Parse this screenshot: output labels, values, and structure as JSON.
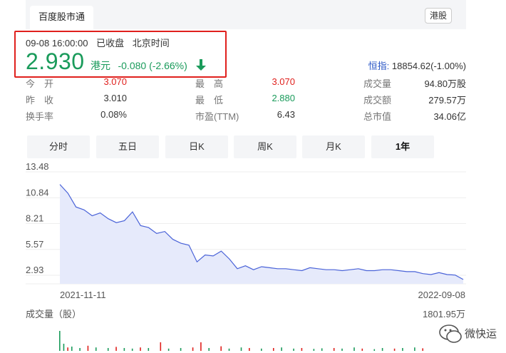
{
  "tab": {
    "label": "百度股市通",
    "badge": "港股"
  },
  "quote": {
    "date": "09-08 16:00:00",
    "status": "已收盘",
    "timezone": "北京时间",
    "price": "2.930",
    "currency": "港元",
    "change": "-0.080 (-2.66%)"
  },
  "index": {
    "label": "恒指:",
    "value": "18854.62(-1.00%)"
  },
  "stats": {
    "row1": [
      {
        "label": "今　开",
        "value": "3.070",
        "color": "red"
      },
      {
        "label": "最　高",
        "value": "3.070",
        "color": "red"
      },
      {
        "label": "成交量",
        "value": "94.80万股"
      }
    ],
    "row2": [
      {
        "label": "昨　收",
        "value": "3.010"
      },
      {
        "label": "最　低",
        "value": "2.880",
        "color": "green"
      },
      {
        "label": "成交额",
        "value": "279.57万"
      }
    ],
    "row3": [
      {
        "label": "换手率",
        "value": "0.08%"
      },
      {
        "label": "市盈(TTM)",
        "value": "6.43"
      },
      {
        "label": "总市值",
        "value": "34.06亿"
      }
    ]
  },
  "periods": [
    "分时",
    "五日",
    "日K",
    "周K",
    "月K",
    "1年"
  ],
  "active_period": "1年",
  "watermark": "微快运",
  "chart_data": {
    "type": "area",
    "y_ticks": [
      "13.48",
      "10.84",
      "8.21",
      "5.57",
      "2.93"
    ],
    "x_labels": [
      "2021-11-11",
      "2022-09-08"
    ],
    "ylim": [
      2.93,
      13.48
    ],
    "line_color": "#4a63d8",
    "fill_color": "#e6eafb",
    "x": [
      0,
      2,
      4,
      6,
      8,
      10,
      12,
      14,
      16,
      18,
      20,
      22,
      24,
      26,
      28,
      30,
      32,
      34,
      36,
      38,
      40,
      42,
      44,
      46,
      48,
      50,
      52,
      54,
      56,
      58,
      60,
      62,
      64,
      66,
      68,
      70,
      72,
      74,
      76,
      78,
      80,
      82,
      84,
      86,
      88,
      90,
      92,
      94,
      96,
      98,
      100
    ],
    "values": [
      12.2,
      11.3,
      9.9,
      9.6,
      9.0,
      9.3,
      8.7,
      8.3,
      8.5,
      9.4,
      8.0,
      7.8,
      7.2,
      7.4,
      6.6,
      6.2,
      6.0,
      4.3,
      5.0,
      4.9,
      5.4,
      4.6,
      3.6,
      3.9,
      3.5,
      3.8,
      3.7,
      3.6,
      3.6,
      3.5,
      3.4,
      3.7,
      3.6,
      3.5,
      3.5,
      3.4,
      3.5,
      3.6,
      3.4,
      3.4,
      3.5,
      3.5,
      3.4,
      3.3,
      3.3,
      3.1,
      3.0,
      3.2,
      3.0,
      2.95,
      2.5
    ],
    "volume_label": "成交量（股）",
    "volume_max": "1801.95万",
    "volume": [
      {
        "x": 0,
        "v": 0.7,
        "c": "g"
      },
      {
        "x": 1,
        "v": 0.25,
        "c": "g"
      },
      {
        "x": 2,
        "v": 0.12,
        "c": "r"
      },
      {
        "x": 3,
        "v": 0.15,
        "c": "g"
      },
      {
        "x": 5,
        "v": 0.1,
        "c": "g"
      },
      {
        "x": 7,
        "v": 0.18,
        "c": "r"
      },
      {
        "x": 9,
        "v": 0.12,
        "c": "g"
      },
      {
        "x": 12,
        "v": 0.1,
        "c": "g"
      },
      {
        "x": 14,
        "v": 0.14,
        "c": "r"
      },
      {
        "x": 16,
        "v": 0.1,
        "c": "g"
      },
      {
        "x": 18,
        "v": 0.08,
        "c": "g"
      },
      {
        "x": 20,
        "v": 0.12,
        "c": "r"
      },
      {
        "x": 22,
        "v": 0.1,
        "c": "g"
      },
      {
        "x": 25,
        "v": 0.3,
        "c": "r"
      },
      {
        "x": 27,
        "v": 0.08,
        "c": "g"
      },
      {
        "x": 30,
        "v": 0.1,
        "c": "g"
      },
      {
        "x": 33,
        "v": 0.12,
        "c": "r"
      },
      {
        "x": 35,
        "v": 0.3,
        "c": "r"
      },
      {
        "x": 37,
        "v": 0.1,
        "c": "g"
      },
      {
        "x": 40,
        "v": 0.16,
        "c": "r"
      },
      {
        "x": 42,
        "v": 0.08,
        "c": "g"
      },
      {
        "x": 45,
        "v": 0.12,
        "c": "g"
      },
      {
        "x": 47,
        "v": 0.1,
        "c": "r"
      },
      {
        "x": 50,
        "v": 0.08,
        "c": "g"
      },
      {
        "x": 53,
        "v": 0.1,
        "c": "r"
      },
      {
        "x": 55,
        "v": 0.12,
        "c": "g"
      },
      {
        "x": 58,
        "v": 0.08,
        "c": "g"
      },
      {
        "x": 60,
        "v": 0.1,
        "c": "r"
      },
      {
        "x": 63,
        "v": 0.07,
        "c": "g"
      },
      {
        "x": 65,
        "v": 0.09,
        "c": "g"
      },
      {
        "x": 68,
        "v": 0.1,
        "c": "r"
      },
      {
        "x": 70,
        "v": 0.08,
        "c": "g"
      },
      {
        "x": 73,
        "v": 0.12,
        "c": "g"
      },
      {
        "x": 75,
        "v": 0.08,
        "c": "r"
      },
      {
        "x": 78,
        "v": 0.06,
        "c": "g"
      },
      {
        "x": 80,
        "v": 0.1,
        "c": "g"
      },
      {
        "x": 83,
        "v": 0.08,
        "c": "r"
      },
      {
        "x": 85,
        "v": 0.1,
        "c": "g"
      },
      {
        "x": 88,
        "v": 0.12,
        "c": "g"
      },
      {
        "x": 90,
        "v": 0.09,
        "c": "r"
      }
    ],
    "colors": {
      "up": "#e0201d",
      "down": "#1a9b5b"
    }
  }
}
